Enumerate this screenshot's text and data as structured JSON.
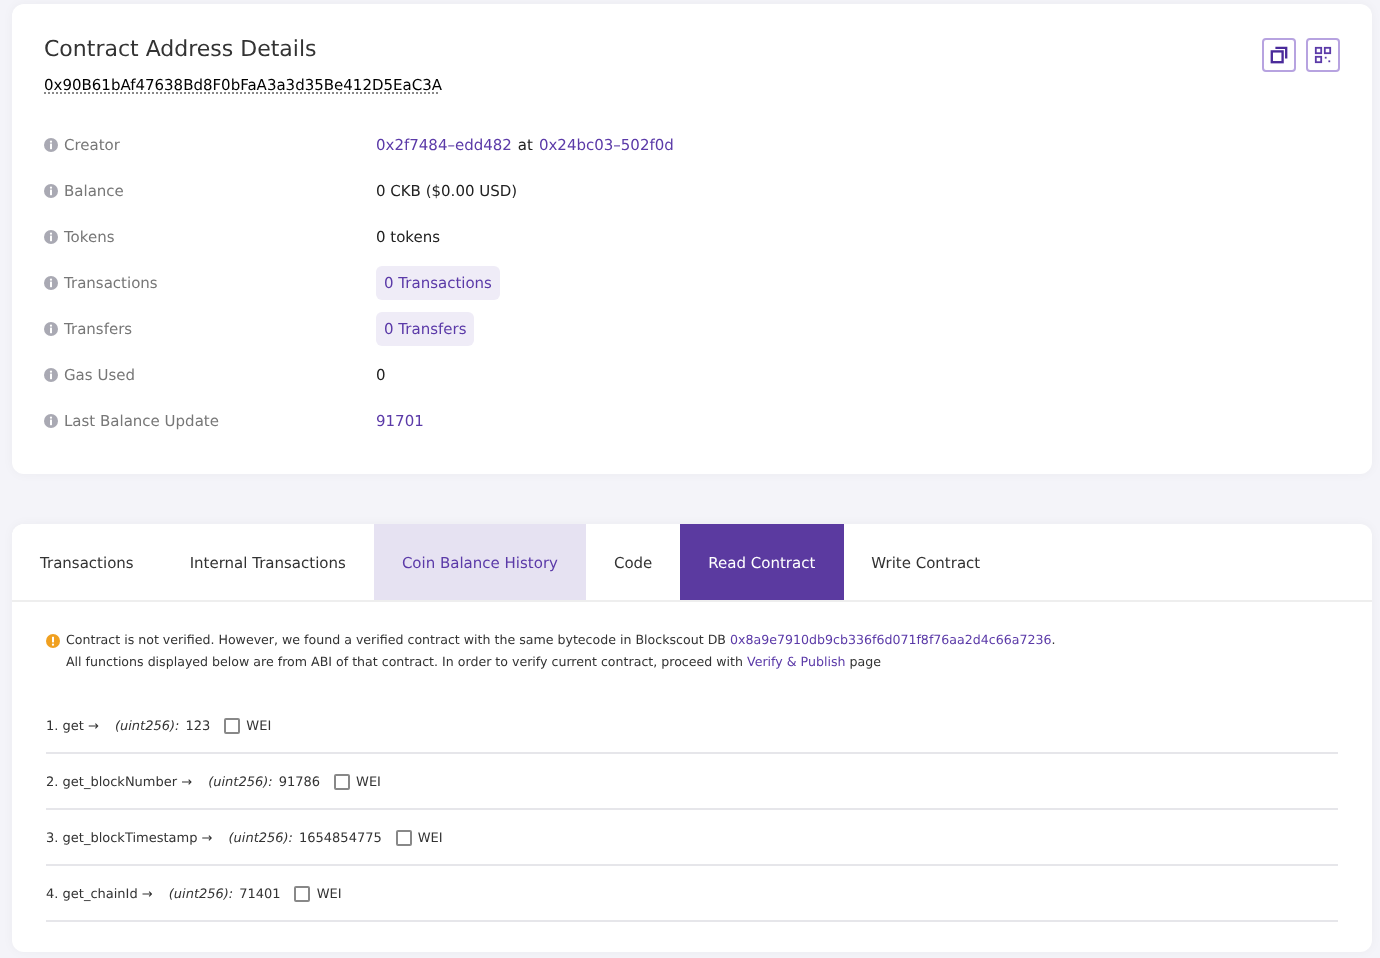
{
  "details": {
    "title": "Contract Address Details",
    "address": "0x90B61bAf47638Bd8F0bFaA3a3d35Be412D5EaC3A",
    "rows": [
      {
        "label": "Creator",
        "kind": "creator",
        "link": "0x2f7484–edd482",
        "middle": "at",
        "link2": "0x24bc03–502f0d"
      },
      {
        "label": "Balance",
        "kind": "text",
        "value": "0 CKB ($0.00 USD)"
      },
      {
        "label": "Tokens",
        "kind": "text",
        "value": "0 tokens"
      },
      {
        "label": "Transactions",
        "kind": "pill",
        "value": "0 Transactions"
      },
      {
        "label": "Transfers",
        "kind": "pill",
        "value": "0 Transfers"
      },
      {
        "label": "Gas Used",
        "kind": "text",
        "value": "0"
      },
      {
        "label": "Last Balance Update",
        "kind": "link",
        "value": "91701"
      }
    ]
  },
  "tabs": [
    {
      "label": "Transactions",
      "selected": false,
      "hovered": false
    },
    {
      "label": "Internal Transactions",
      "selected": false,
      "hovered": false
    },
    {
      "label": "Coin Balance History",
      "selected": false,
      "hovered": true
    },
    {
      "label": "Code",
      "selected": false,
      "hovered": false
    },
    {
      "label": "Read Contract",
      "selected": true,
      "hovered": false
    },
    {
      "label": "Write Contract",
      "selected": false,
      "hovered": false
    }
  ],
  "notice": {
    "lines": [
      {
        "text": "Contract is not verified. However, we found a verified contract with the same bytecode in Blockscout DB ",
        "link": "0x8a9e7910db9cb336f6d071f8f76aa2d4c66a7236",
        "after": "."
      },
      {
        "text": "All functions displayed below are from ABI of that contract. In order to verify current contract, proceed with ",
        "link": "Verify & Publish",
        "after": " page"
      }
    ]
  },
  "functions": [
    {
      "name": "1. get →",
      "type": "(uint256):",
      "value": "123",
      "unit": "WEI",
      "checked": false
    },
    {
      "name": "2. get_blockNumber →",
      "type": "(uint256):",
      "value": "91786",
      "unit": "WEI",
      "checked": false
    },
    {
      "name": "3. get_blockTimestamp →",
      "type": "(uint256):",
      "value": "1654854775",
      "unit": "WEI",
      "checked": false
    },
    {
      "name": "4. get_chainId →",
      "type": "(uint256):",
      "value": "71401",
      "unit": "WEI",
      "checked": false
    }
  ]
}
